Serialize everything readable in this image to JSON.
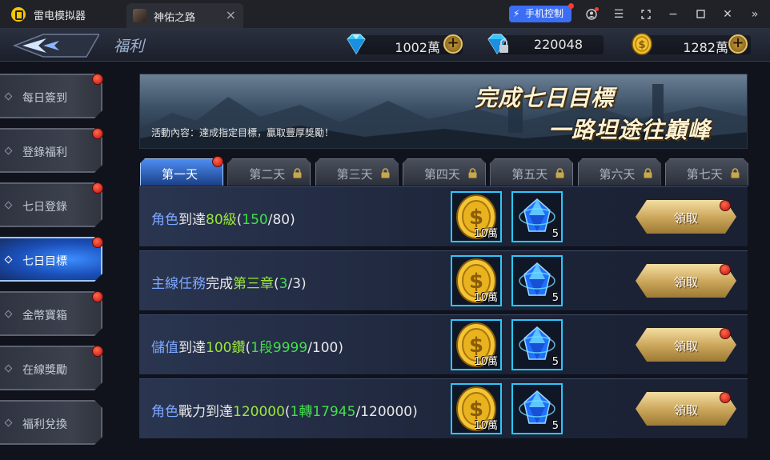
{
  "emulator": {
    "app_name": "雷电模拟器",
    "tab_title": "神佑之路",
    "phone_control_label": "手机控制"
  },
  "game": {
    "page_title": "福利",
    "currencies": [
      {
        "icon": "diamond-icon",
        "value": "1002萬"
      },
      {
        "icon": "locked-diamond-icon",
        "value": "220048"
      },
      {
        "icon": "gold-coin-icon",
        "value": "1282萬"
      }
    ],
    "sidebar": [
      {
        "label": "每日簽到",
        "badge": true,
        "active": false
      },
      {
        "label": "登錄福利",
        "badge": true,
        "active": false
      },
      {
        "label": "七日登錄",
        "badge": true,
        "active": false
      },
      {
        "label": "七日目標",
        "badge": true,
        "active": true
      },
      {
        "label": "金幣寶箱",
        "badge": true,
        "active": false
      },
      {
        "label": "在線獎勵",
        "badge": true,
        "active": false
      },
      {
        "label": "福利兌換",
        "badge": false,
        "active": false
      }
    ],
    "banner": {
      "description": "活動內容：達成指定目標，贏取豐厚獎勵！",
      "title_line1": "完成七日目標",
      "title_line2": "一路坦途往巔峰"
    },
    "day_tabs": [
      {
        "label": "第一天",
        "active": true,
        "locked": false,
        "badge": true
      },
      {
        "label": "第二天",
        "active": false,
        "locked": true,
        "badge": false
      },
      {
        "label": "第三天",
        "active": false,
        "locked": true,
        "badge": false
      },
      {
        "label": "第四天",
        "active": false,
        "locked": true,
        "badge": false
      },
      {
        "label": "第五天",
        "active": false,
        "locked": true,
        "badge": false
      },
      {
        "label": "第六天",
        "active": false,
        "locked": true,
        "badge": false
      },
      {
        "label": "第七天",
        "active": false,
        "locked": true,
        "badge": false
      }
    ],
    "tasks": [
      {
        "parts": [
          [
            "角色",
            "blue"
          ],
          [
            "到達",
            "white"
          ],
          [
            "80級",
            "green"
          ],
          [
            "(",
            "white"
          ],
          [
            "150",
            "green2"
          ],
          [
            "/80)",
            "white"
          ]
        ],
        "rewards": [
          {
            "icon": "gold-coin-icon",
            "count": "10萬"
          },
          {
            "icon": "blue-crystal-icon",
            "count": "5"
          }
        ],
        "button": "領取"
      },
      {
        "parts": [
          [
            "主線任務",
            "blue"
          ],
          [
            "完成",
            "white"
          ],
          [
            "第三章",
            "green"
          ],
          [
            "(",
            "white"
          ],
          [
            "3",
            "green2"
          ],
          [
            "/3)",
            "white"
          ]
        ],
        "rewards": [
          {
            "icon": "gold-coin-icon",
            "count": "10萬"
          },
          {
            "icon": "blue-crystal-icon",
            "count": "5"
          }
        ],
        "button": "領取"
      },
      {
        "parts": [
          [
            "儲值",
            "blue"
          ],
          [
            "到達",
            "white"
          ],
          [
            "100鑽",
            "green"
          ],
          [
            "(",
            "white"
          ],
          [
            "1段9999",
            "green2"
          ],
          [
            "/100)",
            "white"
          ]
        ],
        "rewards": [
          {
            "icon": "gold-coin-icon",
            "count": "10萬"
          },
          {
            "icon": "blue-crystal-icon",
            "count": "5"
          }
        ],
        "button": "領取"
      },
      {
        "parts": [
          [
            "角色",
            "blue"
          ],
          [
            "戰力到達",
            "white"
          ],
          [
            "120000",
            "green"
          ],
          [
            "(",
            "white"
          ],
          [
            "1轉17945",
            "green2"
          ],
          [
            "/120000)",
            "white"
          ]
        ],
        "rewards": [
          {
            "icon": "gold-coin-icon",
            "count": "10萬"
          },
          {
            "icon": "blue-crystal-icon",
            "count": "5"
          }
        ],
        "button": "領取"
      }
    ]
  }
}
